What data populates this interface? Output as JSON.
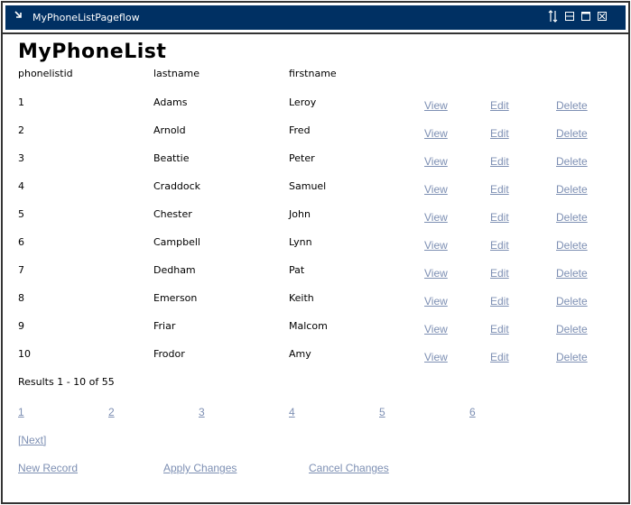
{
  "window": {
    "title": "MyPhoneListPageflow",
    "icons": [
      "restore-arrow-icon",
      "move-updown-icon",
      "minimize-icon",
      "maximize-icon",
      "close-icon"
    ]
  },
  "page": {
    "heading": "MyPhoneList"
  },
  "table": {
    "headers": [
      "phonelistid",
      "lastname",
      "firstname"
    ],
    "action_labels": {
      "view": "View",
      "edit": "Edit",
      "delete": "Delete"
    },
    "rows": [
      {
        "id": "1",
        "lastname": "Adams",
        "firstname": "Leroy"
      },
      {
        "id": "2",
        "lastname": "Arnold",
        "firstname": "Fred"
      },
      {
        "id": "3",
        "lastname": "Beattie",
        "firstname": "Peter"
      },
      {
        "id": "4",
        "lastname": "Craddock",
        "firstname": "Samuel"
      },
      {
        "id": "5",
        "lastname": "Chester",
        "firstname": "John"
      },
      {
        "id": "6",
        "lastname": "Campbell",
        "firstname": "Lynn"
      },
      {
        "id": "7",
        "lastname": "Dedham",
        "firstname": "Pat"
      },
      {
        "id": "8",
        "lastname": "Emerson",
        "firstname": "Keith"
      },
      {
        "id": "9",
        "lastname": "Friar",
        "firstname": "Malcom"
      },
      {
        "id": "10",
        "lastname": "Frodor",
        "firstname": "Amy"
      }
    ]
  },
  "pagination": {
    "summary": "Results 1 - 10 of 55",
    "pages": [
      "1",
      "2",
      "3",
      "4",
      "5",
      "6"
    ],
    "next": "[Next]"
  },
  "actions": {
    "new_record": "New Record",
    "apply_changes": "Apply Changes",
    "cancel_changes": "Cancel Changes"
  },
  "colors": {
    "titlebar_bg": "#003063",
    "link": "#7d8fb3",
    "border": "#333333"
  }
}
